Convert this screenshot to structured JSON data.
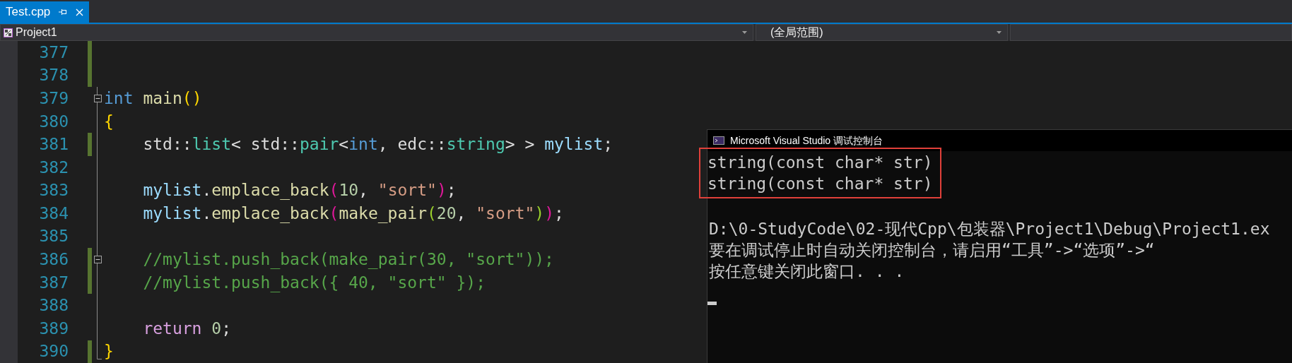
{
  "tabs": [
    {
      "label": "Test.cpp",
      "selected": true,
      "pinned": false
    }
  ],
  "nav_bar": {
    "project": "Project1",
    "scope": "(全局范围)"
  },
  "code_lines": [
    {
      "number": "377",
      "changed": true,
      "collapsible": false,
      "outline": false
    },
    {
      "number": "378",
      "changed": true,
      "collapsible": false,
      "outline": false
    },
    {
      "number": "379",
      "changed": false,
      "collapsible": true,
      "outline": true,
      "tokens": [
        {
          "text": "int ",
          "kind": "keyword"
        },
        {
          "text": "main",
          "kind": "function"
        },
        {
          "text": "()",
          "kind": "bracket1"
        }
      ]
    },
    {
      "number": "380",
      "changed": false,
      "collapsible": false,
      "outline": true,
      "tokens": [
        {
          "text": "{",
          "kind": "bracket1"
        }
      ]
    },
    {
      "number": "381",
      "changed": true,
      "collapsible": false,
      "outline": true,
      "tokens": [
        {
          "text": "    std::",
          "kind": "plain"
        },
        {
          "text": "list",
          "kind": "type"
        },
        {
          "text": "< std::",
          "kind": "plain"
        },
        {
          "text": "pair",
          "kind": "type"
        },
        {
          "text": "<",
          "kind": "plain"
        },
        {
          "text": "int",
          "kind": "keyword"
        },
        {
          "text": ", edc::",
          "kind": "plain"
        },
        {
          "text": "string",
          "kind": "type"
        },
        {
          "text": "> > ",
          "kind": "plain"
        },
        {
          "text": "mylist",
          "kind": "variable"
        },
        {
          "text": ";",
          "kind": "plain"
        }
      ]
    },
    {
      "number": "382",
      "changed": false,
      "collapsible": false,
      "outline": true
    },
    {
      "number": "383",
      "changed": false,
      "collapsible": false,
      "outline": true,
      "tokens": [
        {
          "text": "    mylist",
          "kind": "variable"
        },
        {
          "text": ".",
          "kind": "plain"
        },
        {
          "text": "emplace_back",
          "kind": "function"
        },
        {
          "text": "(",
          "kind": "bracket2"
        },
        {
          "text": "10",
          "kind": "number"
        },
        {
          "text": ", ",
          "kind": "plain"
        },
        {
          "text": "\"sort\"",
          "kind": "string"
        },
        {
          "text": ")",
          "kind": "bracket2"
        },
        {
          "text": ";",
          "kind": "plain"
        }
      ]
    },
    {
      "number": "384",
      "changed": false,
      "collapsible": false,
      "outline": true,
      "tokens": [
        {
          "text": "    mylist",
          "kind": "variable"
        },
        {
          "text": ".",
          "kind": "plain"
        },
        {
          "text": "emplace_back",
          "kind": "function"
        },
        {
          "text": "(",
          "kind": "bracket2"
        },
        {
          "text": "make_pair",
          "kind": "function"
        },
        {
          "text": "(",
          "kind": "bracket3"
        },
        {
          "text": "20",
          "kind": "number"
        },
        {
          "text": ", ",
          "kind": "plain"
        },
        {
          "text": "\"sort\"",
          "kind": "string"
        },
        {
          "text": ")",
          "kind": "bracket3"
        },
        {
          "text": ")",
          "kind": "bracket2"
        },
        {
          "text": ";",
          "kind": "plain"
        }
      ]
    },
    {
      "number": "385",
      "changed": false,
      "collapsible": false,
      "outline": true
    },
    {
      "number": "386",
      "changed": true,
      "collapsible": true,
      "outline": true,
      "tokens": [
        {
          "text": "    //mylist.push_back(make_pair(30, \"sort\"));",
          "kind": "comment"
        }
      ]
    },
    {
      "number": "387",
      "changed": true,
      "collapsible": false,
      "outline": true,
      "tokens": [
        {
          "text": "    //mylist.push_back({ 40, \"sort\" });",
          "kind": "comment"
        }
      ]
    },
    {
      "number": "388",
      "changed": false,
      "collapsible": false,
      "outline": true
    },
    {
      "number": "389",
      "changed": false,
      "collapsible": false,
      "outline": true,
      "tokens": [
        {
          "text": "    return ",
          "kind": "control"
        },
        {
          "text": "0",
          "kind": "number"
        },
        {
          "text": ";",
          "kind": "plain"
        }
      ]
    },
    {
      "number": "390",
      "changed": true,
      "collapsible": false,
      "outline": true,
      "tokens": [
        {
          "text": "}",
          "kind": "bracket1"
        }
      ]
    }
  ],
  "console": {
    "title": "Microsoft Visual Studio 调试控制台",
    "output_blocks": [
      {
        "highlighted": true,
        "lines": [
          "string(const char* str)",
          "string(const char* str)"
        ]
      },
      {
        "highlighted": false,
        "lines": [
          "D:\\0-StudyCode\\02-现代Cpp\\包装器\\Project1\\Debug\\Project1.ex",
          "要在调试停止时自动关闭控制台，请启用“工具”->“选项”->“",
          "按任意键关闭此窗口. . ."
        ]
      }
    ]
  }
}
